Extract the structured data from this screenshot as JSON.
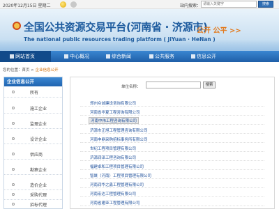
{
  "topbar": {
    "date": "2020年12月15日 星期二",
    "weather_icon": "sun-icon",
    "moon_icon": "moon-icon",
    "search_label": "站内搜索：",
    "search_placeholder": "请输入关键字",
    "search_button": "搜索"
  },
  "banner": {
    "title": "全国公共资源交易平台(河南省 · 济源市)",
    "subtitle": "The national public resources trading platform ( JiYuan · HeNan )",
    "slogan": "公开 公平 >>",
    "emblem_icon": "emblem-icon"
  },
  "nav": {
    "items": [
      {
        "label": "网站首页",
        "icon": "home-icon"
      },
      {
        "label": "中心概况",
        "icon": "info-icon"
      },
      {
        "label": "综合新闻",
        "icon": "news-icon"
      },
      {
        "label": "公共服务",
        "icon": "service-icon"
      },
      {
        "label": "信息公开",
        "icon": "document-icon"
      }
    ]
  },
  "breadcrumb": {
    "prefix": "您的位置：",
    "home": "首页",
    "separator": " > ",
    "current": "企业信息公开"
  },
  "sidebar": {
    "title": "企业信息公开",
    "items": [
      {
        "label": "所有"
      },
      {
        "label": "施工企业"
      },
      {
        "label": "监理企业"
      },
      {
        "label": "设计企业"
      },
      {
        "label": "供应商"
      },
      {
        "label": "勘察企业"
      },
      {
        "label": "造价企业"
      },
      {
        "label": "采购代理"
      },
      {
        "label": "招标代理"
      }
    ]
  },
  "main": {
    "filter_label": "单位名称：",
    "filter_button": "搜索",
    "rows": [
      {
        "name": "郑州众诚建设咨询有限公司"
      },
      {
        "name": "河南省华夏工程咨询有限公司"
      },
      {
        "name": "河南中伟工程咨询有限公司"
      },
      {
        "name": "济源市正旭工程管理咨询有限公司"
      },
      {
        "name": "河南申鼎采购招标事务所有限公司"
      },
      {
        "name": "世纪工程项目管理有限公司"
      },
      {
        "name": "济源润泽工程咨询有限公司"
      },
      {
        "name": "福建卓和工程项目管理有限公司"
      },
      {
        "name": "智晟（河南）工程项目管理有限公司"
      },
      {
        "name": "河南润华之鑫工程管理有限公司"
      },
      {
        "name": "河南宏达工程管理有限公司"
      },
      {
        "name": "河南省建亚工程管理有限公司"
      }
    ]
  }
}
